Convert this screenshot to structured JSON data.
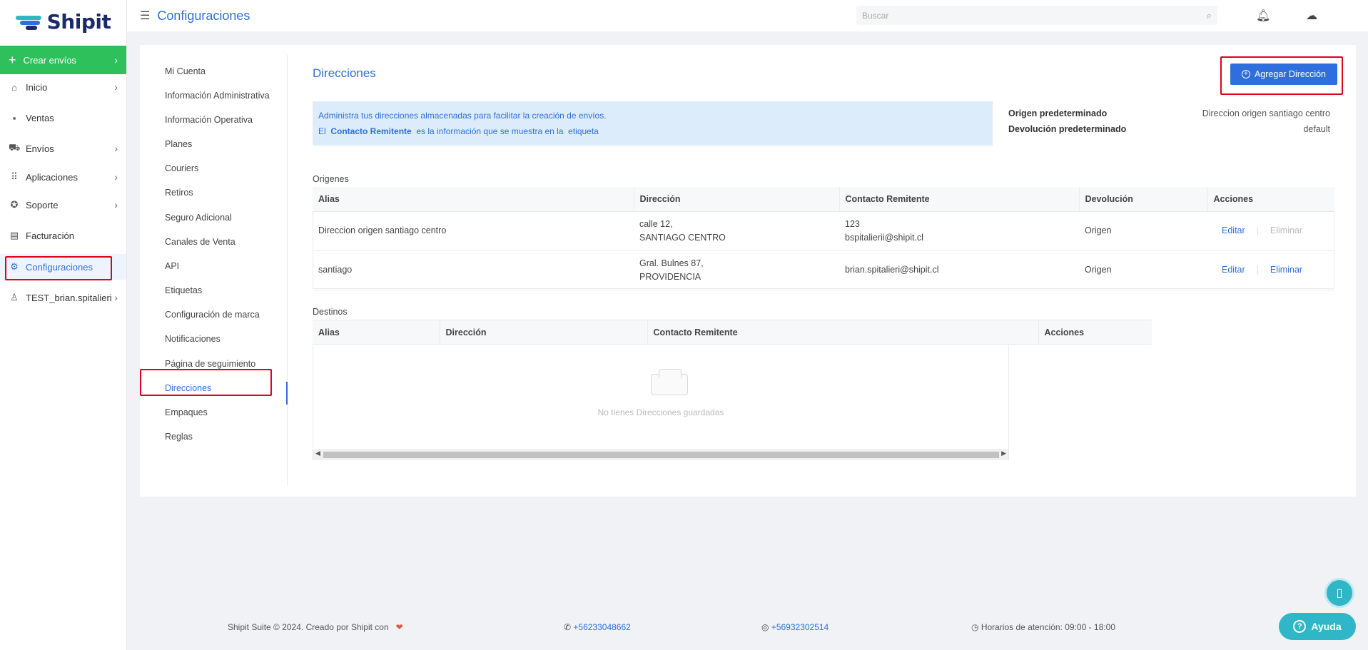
{
  "brand": {
    "name": "Shipit",
    "logo_colors": [
      "#2fb7c7",
      "#1a2a6c"
    ]
  },
  "sidebar": {
    "create_label": "Crear envíos",
    "items": [
      {
        "label": "Inicio",
        "icon": "home-icon",
        "has_children": true
      },
      {
        "label": "Ventas",
        "icon": "boxes-icon",
        "has_children": false
      },
      {
        "label": "Envíos",
        "icon": "truck-icon",
        "has_children": true
      },
      {
        "label": "Aplicaciones",
        "icon": "grid-icon",
        "has_children": true
      },
      {
        "label": "Soporte",
        "icon": "lifebuoy-icon",
        "has_children": true
      },
      {
        "label": "Facturación",
        "icon": "invoice-icon",
        "has_children": false
      },
      {
        "label": "Configuraciones",
        "icon": "gear-icon",
        "has_children": false,
        "active": true
      },
      {
        "label": "TEST_brian.spitalieri",
        "icon": "user-icon",
        "has_children": true
      }
    ]
  },
  "header": {
    "title": "Configuraciones",
    "search_placeholder": "Buscar"
  },
  "submenu": {
    "items": [
      "Mi Cuenta",
      "Información Administrativa",
      "Información Operativa",
      "Planes",
      "Couriers",
      "Retiros",
      "Seguro Adicional",
      "Canales de Venta",
      "API",
      "Etiquetas",
      "Configuración de marca",
      "Notificaciones",
      "Página de seguimiento",
      "Direcciones",
      "Empaques",
      "Reglas"
    ],
    "active": "Direcciones"
  },
  "content": {
    "title": "Direcciones",
    "add_button": "Agregar Dirección",
    "info_line1": "Administra tus direcciones almacenadas para facilitar la creación de envíos.",
    "info_line2_a": "El",
    "info_line2_b": "Contacto Remitente",
    "info_line2_c": "es la información que se muestra en la",
    "info_line2_d": "etiqueta",
    "defaults": {
      "origin_label": "Origen predeterminado",
      "origin_value": "Direccion origen santiago centro",
      "return_label": "Devolución predeterminado",
      "return_value": "default"
    },
    "origins": {
      "label": "Origenes",
      "columns": [
        "Alias",
        "Dirección",
        "Contacto Remitente",
        "Devolución",
        "Acciones"
      ],
      "rows": [
        {
          "alias": "Direccion origen santiago centro",
          "address1": "calle 12,",
          "address2": "SANTIAGO CENTRO",
          "contact1": "123",
          "contact2": "bspitalierii@shipit.cl",
          "return": "Origen",
          "edit": "Editar",
          "delete": "Eliminar",
          "delete_enabled": false
        },
        {
          "alias": "santiago",
          "address1": "Gral. Bulnes 87,",
          "address2": "PROVIDENCIA",
          "contact1": "brian.spitalieri@shipit.cl",
          "contact2": "",
          "return": "Origen",
          "edit": "Editar",
          "delete": "Eliminar",
          "delete_enabled": true
        }
      ]
    },
    "destinations": {
      "label": "Destinos",
      "columns": [
        "Alias",
        "Dirección",
        "Contacto Remitente",
        "Acciones"
      ],
      "empty_text": "No tienes Direcciones guardadas"
    }
  },
  "footer": {
    "copyright": "Shipit Suite © 2024. Creado por Shipit con",
    "phone": "+56233048662",
    "whatsapp": "+56932302514",
    "hours": "Horarios de atención: 09:00 - 18:00"
  },
  "help_button": "Ayuda",
  "colors": {
    "accent": "#2f6fdd",
    "create": "#2ec05a",
    "highlight": "#e2001a",
    "help": "#2fb7c7"
  }
}
